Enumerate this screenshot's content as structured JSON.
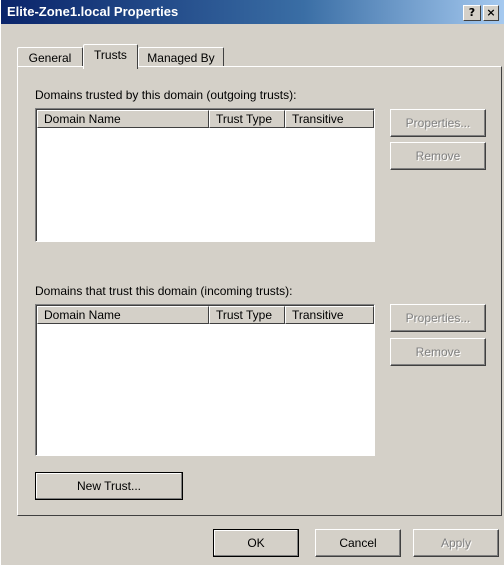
{
  "window": {
    "title": "Elite-Zone1.local Properties",
    "help_label": "?",
    "close_label": "×"
  },
  "tabs": [
    {
      "label": "General",
      "active": false
    },
    {
      "label": "Trusts",
      "active": true
    },
    {
      "label": "Managed By",
      "active": false
    }
  ],
  "outgoing": {
    "label": "Domains trusted by this domain (outgoing trusts):",
    "columns": [
      "Domain Name",
      "Trust Type",
      "Transitive"
    ],
    "properties_label": "Properties...",
    "remove_label": "Remove"
  },
  "incoming": {
    "label": "Domains that trust this domain (incoming trusts):",
    "columns": [
      "Domain Name",
      "Trust Type",
      "Transitive"
    ],
    "properties_label": "Properties...",
    "remove_label": "Remove"
  },
  "new_trust_label": "New Trust...",
  "footer": {
    "ok_label": "OK",
    "cancel_label": "Cancel",
    "apply_label": "Apply"
  }
}
